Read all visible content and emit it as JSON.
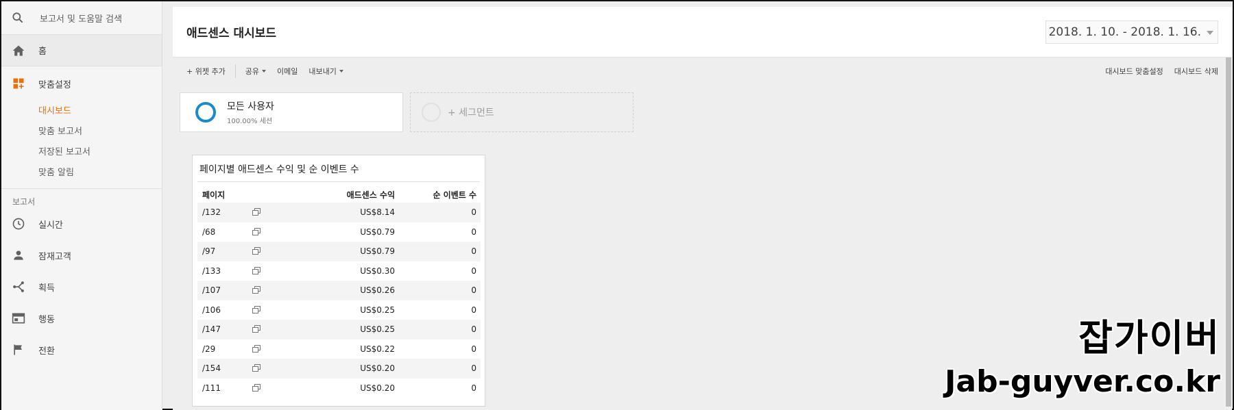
{
  "sidebar": {
    "search_placeholder": "보고서 및 도움말 검색",
    "home": "홈",
    "customization": "맞춤설정",
    "custom_items": [
      "대시보드",
      "맞춤 보고서",
      "저장된 보고서",
      "맞춤 알림"
    ],
    "reports_section": "보고서",
    "report_items": [
      "실시간",
      "잠재고객",
      "획득",
      "행동",
      "전환"
    ],
    "accent_color": "#e8710a"
  },
  "header": {
    "title": "애드센스 대시보드",
    "date_range": "2018. 1. 10. - 2018. 1. 16."
  },
  "toolbar": {
    "add_widget": "+ 위젯 추가",
    "share": "공유",
    "email": "이메일",
    "export": "내보내기",
    "customize_dashboard": "대시보드 맞춤설정",
    "delete_dashboard": "대시보드 삭제"
  },
  "segments": {
    "all_users": "모든 사용자",
    "all_users_sub": "100.00% 세션",
    "add_segment": "+ 세그먼트",
    "ring_color": "#1a8bc7"
  },
  "widget": {
    "title": "페이지별 애드센스 수익 및 순 이벤트 수",
    "headers": [
      "페이지",
      "애드센스 수익",
      "순 이벤트 수"
    ],
    "rows": [
      {
        "page": "/132",
        "revenue": "US$8.14",
        "events": "0"
      },
      {
        "page": "/68",
        "revenue": "US$0.79",
        "events": "0"
      },
      {
        "page": "/97",
        "revenue": "US$0.79",
        "events": "0"
      },
      {
        "page": "/133",
        "revenue": "US$0.30",
        "events": "0"
      },
      {
        "page": "/107",
        "revenue": "US$0.26",
        "events": "0"
      },
      {
        "page": "/106",
        "revenue": "US$0.25",
        "events": "0"
      },
      {
        "page": "/147",
        "revenue": "US$0.25",
        "events": "0"
      },
      {
        "page": "/29",
        "revenue": "US$0.22",
        "events": "0"
      },
      {
        "page": "/154",
        "revenue": "US$0.20",
        "events": "0"
      },
      {
        "page": "/111",
        "revenue": "US$0.20",
        "events": "0"
      }
    ]
  },
  "watermark": {
    "line1": "잡가이버",
    "line2": "Jab-guyver.co.kr"
  }
}
